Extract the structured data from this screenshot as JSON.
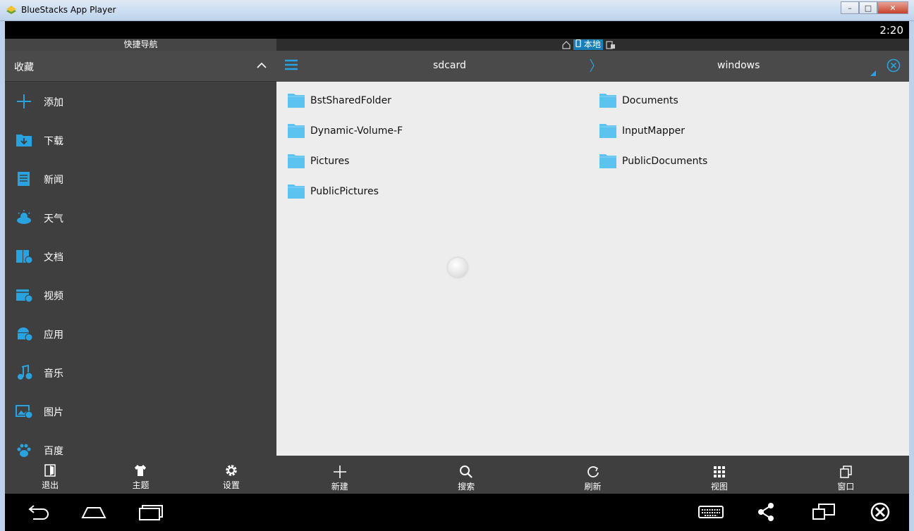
{
  "window": {
    "title": "BlueStacks App Player"
  },
  "status_bar": {
    "time": "2:20"
  },
  "left": {
    "header": "快捷导航",
    "favorites_label": "收藏",
    "items": [
      {
        "label": "添加",
        "icon": "plus-icon"
      },
      {
        "label": "下载",
        "icon": "download-folder-icon"
      },
      {
        "label": "新闻",
        "icon": "news-icon"
      },
      {
        "label": "天气",
        "icon": "weather-icon"
      },
      {
        "label": "文档",
        "icon": "document-icon"
      },
      {
        "label": "视频",
        "icon": "video-icon"
      },
      {
        "label": "应用",
        "icon": "android-app-icon"
      },
      {
        "label": "音乐",
        "icon": "music-icon"
      },
      {
        "label": "图片",
        "icon": "picture-icon"
      },
      {
        "label": "百度",
        "icon": "baidu-paw-icon"
      }
    ],
    "bottom": [
      {
        "label": "退出"
      },
      {
        "label": "主题"
      },
      {
        "label": "设置"
      }
    ]
  },
  "right": {
    "location_tab_active": "本地",
    "path": [
      "sdcard",
      "windows"
    ],
    "folders": [
      "BstSharedFolder",
      "Documents",
      "Dynamic-Volume-F",
      "InputMapper",
      "Pictures",
      "PublicDocuments",
      "PublicPictures"
    ],
    "bottom": [
      {
        "label": "新建"
      },
      {
        "label": "搜索"
      },
      {
        "label": "刷新"
      },
      {
        "label": "视图"
      },
      {
        "label": "窗口"
      }
    ]
  },
  "colors": {
    "accent": "#29a3e0",
    "folder": "#5cc2ef",
    "panel_dark": "#3f3f3f",
    "content_bg": "#ededed"
  }
}
